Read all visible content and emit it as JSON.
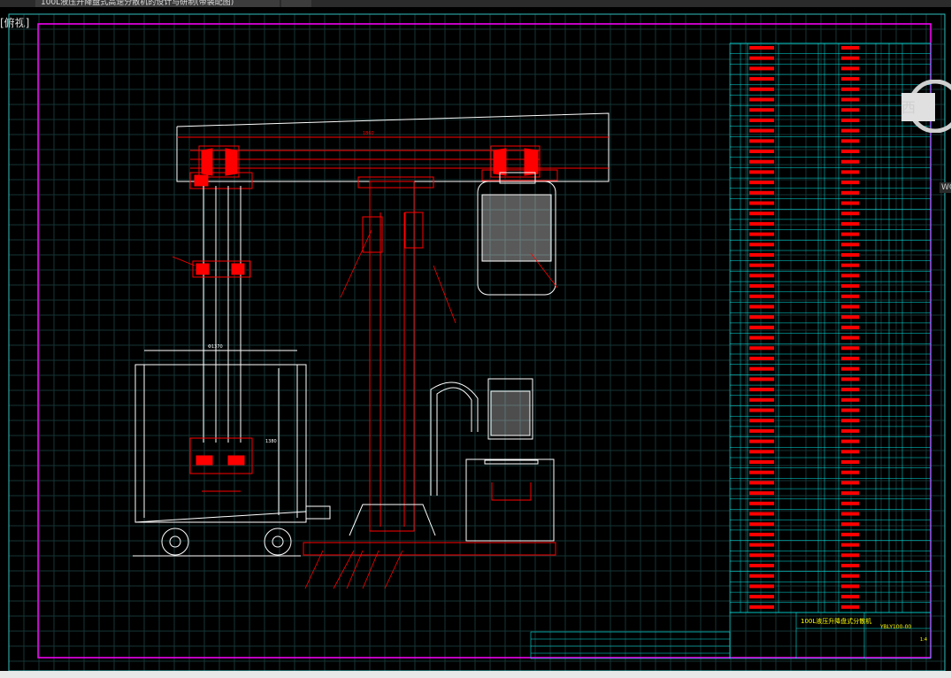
{
  "window": {
    "tabs": [
      {
        "label": "100L液压升降盘式高速分散机的设计与研制(带装配图)"
      },
      {
        "label": ""
      }
    ]
  },
  "viewport": {
    "label": "[俯视]"
  },
  "navigation": {
    "viewcube_label": "西",
    "wcs_label": "WCS"
  },
  "drawing": {
    "dim_top": "1860",
    "dim_tank_width": "Φ1370",
    "dim_tank_height": "1380",
    "title_block": {
      "name": "100L液压升降盘式分散机",
      "drawing_no": "YBLY100-00",
      "sheet": "1:4"
    }
  },
  "colors": {
    "background": "#000000",
    "frame": "#ff00ff",
    "grid": "#1a3a3a",
    "parts": "#ff0000",
    "outline": "#ffffff",
    "table": "#00e5e5"
  }
}
